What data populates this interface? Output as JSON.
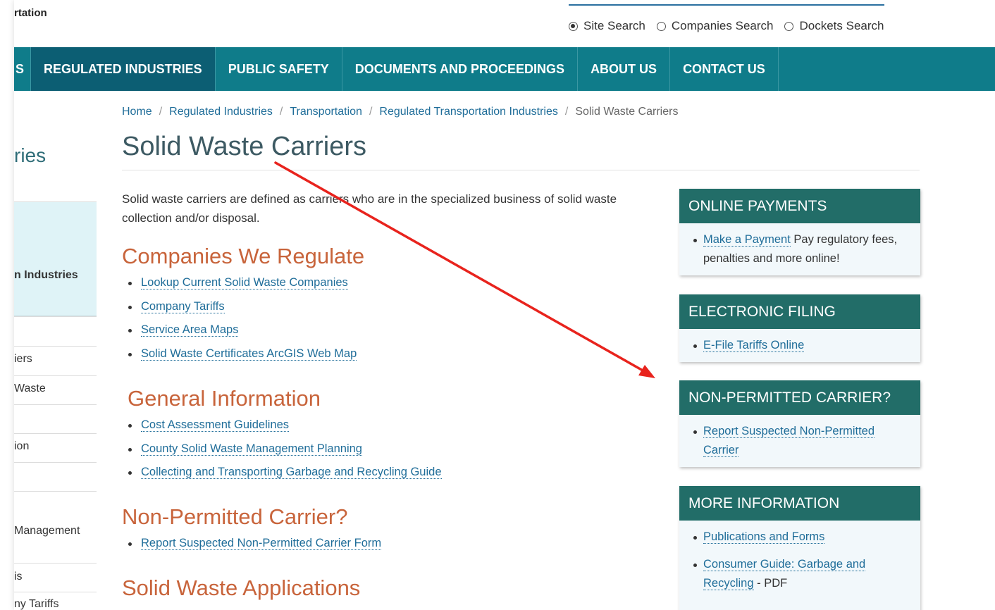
{
  "header": {
    "logo_fragment": "rtation",
    "search_options": [
      {
        "label": "Site Search",
        "checked": true
      },
      {
        "label": "Companies Search",
        "checked": false
      },
      {
        "label": "Dockets Search",
        "checked": false
      }
    ]
  },
  "nav": {
    "stub_label": "S",
    "items": [
      "REGULATED INDUSTRIES",
      "PUBLIC SAFETY",
      "DOCUMENTS AND PROCEEDINGS",
      "ABOUT US",
      "CONTACT US"
    ]
  },
  "sidebar": {
    "title": "ries",
    "items": [
      "n Industries",
      "iers",
      "Waste",
      "ion",
      "Management",
      "is",
      "ny Tariffs"
    ]
  },
  "breadcrumb": {
    "links": [
      "Home",
      "Regulated Industries",
      "Transportation",
      "Regulated Transportation Industries"
    ],
    "current": "Solid Waste Carriers",
    "separator": "/"
  },
  "main": {
    "title": "Solid Waste Carriers",
    "intro": "Solid waste carriers are defined as carriers who are in the specialized business of solid waste collection and/or disposal.",
    "sections": [
      {
        "heading": "Companies We Regulate",
        "links": [
          "Lookup Current Solid Waste Companies",
          "Company Tariffs",
          "Service Area Maps",
          "Solid Waste Certificates ArcGIS Web Map"
        ]
      },
      {
        "heading": "General Information",
        "links": [
          "Cost Assessment Guidelines",
          "County Solid Waste Management Planning",
          "Collecting and Transporting Garbage and Recycling Guide"
        ]
      },
      {
        "heading": "Non-Permitted Carrier?",
        "links": [
          "Report Suspected Non-Permitted Carrier Form"
        ]
      },
      {
        "heading": "Solid Waste Applications",
        "links": []
      }
    ]
  },
  "panels": [
    {
      "heading": "ONLINE PAYMENTS",
      "items": [
        {
          "link": "Make a Payment",
          "text": " Pay regulatory fees, penalties and more online!"
        }
      ]
    },
    {
      "heading": "ELECTRONIC FILING",
      "items": [
        {
          "link": "E-File Tariffs Online",
          "text": ""
        }
      ]
    },
    {
      "heading": "NON-PERMITTED CARRIER?",
      "items": [
        {
          "link": "Report Suspected Non-Permitted Carrier",
          "text": ""
        }
      ]
    },
    {
      "heading": "MORE INFORMATION",
      "items": [
        {
          "link": "Publications and Forms",
          "text": ""
        },
        {
          "link": "Consumer Guide: Garbage and Recycling",
          "text": " - PDF"
        }
      ]
    }
  ],
  "colors": {
    "nav_bg": "#0f7c8a",
    "nav_active": "#0c5e73",
    "panel_head": "#226d68",
    "section_heading": "#c8643b",
    "link": "#1f6d99",
    "annotation_arrow": "#e8231d"
  }
}
